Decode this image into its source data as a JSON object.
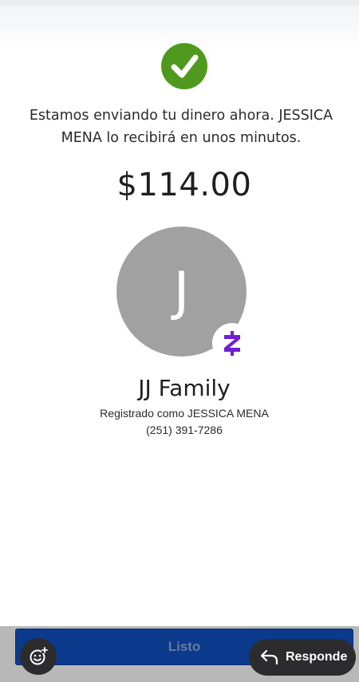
{
  "confirmation": {
    "message": "Estamos enviando tu dinero ahora. JESSICA MENA lo recibirá en unos minutos.",
    "amount": "$114.00"
  },
  "recipient": {
    "avatar_initial": "J",
    "badge_icon": "zelle-logo",
    "name": "JJ Family",
    "registered_as": "Registrado como JESSICA MENA",
    "phone": "(251) 391-7286"
  },
  "actions": {
    "done_label": "Listo"
  },
  "overlay": {
    "emoji_icon": "emoji-add-icon",
    "reply_icon": "reply-arrow-icon",
    "reply_label": "Responde"
  },
  "colors": {
    "success_green": "#4f9a1e",
    "zelle_purple": "#6d1ed4",
    "button_blue": "#0b3a8c",
    "avatar_gray": "#a1a1a1",
    "overlay_dark": "#2c2c2e"
  }
}
